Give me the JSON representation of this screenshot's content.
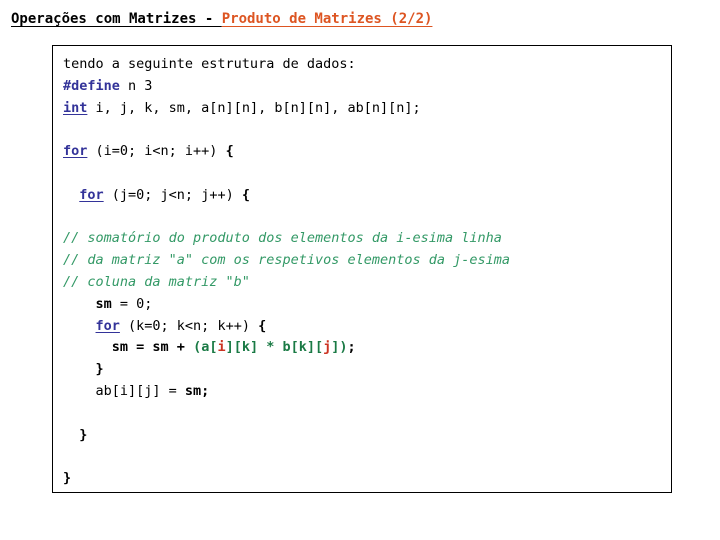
{
  "title": {
    "main": "Operações com Matrizes - ",
    "accent": "Produto de Matrizes (2/2)"
  },
  "colors": {
    "title_black": "#000000",
    "title_accent": "#dd5522",
    "keyword_navy": "#333399",
    "comment_green": "#339966",
    "expression_green": "#1a7a45",
    "index_red": "#cc3322",
    "border": "#000000",
    "background": "#ffffff"
  },
  "code": {
    "language": "C",
    "lines": [
      {
        "id": "line-1",
        "tokens": [
          {
            "style": "plain",
            "text": "tendo a seguinte estrutura de dados:"
          }
        ]
      },
      {
        "id": "line-2",
        "tokens": [
          {
            "style": "kw",
            "text": "#define"
          },
          {
            "style": "plain",
            "text": " n 3"
          }
        ]
      },
      {
        "id": "line-3",
        "tokens": [
          {
            "style": "kw-u",
            "text": "int"
          },
          {
            "style": "plain",
            "text": " i, j, k, sm, a[n][n], b[n][n], ab[n][n];"
          }
        ]
      },
      {
        "id": "line-4",
        "tokens": [
          {
            "style": "plain",
            "text": ""
          }
        ]
      },
      {
        "id": "line-5",
        "tokens": [
          {
            "style": "kw-u",
            "text": "for"
          },
          {
            "style": "plain",
            "text": " (i=0; i<n; i++) "
          },
          {
            "style": "bold",
            "text": "{"
          }
        ]
      },
      {
        "id": "line-6",
        "tokens": [
          {
            "style": "plain",
            "text": ""
          }
        ]
      },
      {
        "id": "line-7",
        "tokens": [
          {
            "style": "plain",
            "text": "  "
          },
          {
            "style": "kw-u",
            "text": "for"
          },
          {
            "style": "plain",
            "text": " (j=0; j<n; j++) "
          },
          {
            "style": "bold",
            "text": "{"
          }
        ]
      },
      {
        "id": "line-8",
        "tokens": [
          {
            "style": "plain",
            "text": ""
          }
        ]
      },
      {
        "id": "line-9",
        "tokens": [
          {
            "style": "comment",
            "text": "// somatório do produto dos elementos da i-esima linha"
          }
        ]
      },
      {
        "id": "line-10",
        "tokens": [
          {
            "style": "comment",
            "text": "// da matriz \"a\" com os respetivos elementos da j-esima"
          }
        ]
      },
      {
        "id": "line-11",
        "tokens": [
          {
            "style": "comment",
            "text": "// coluna da matriz \"b\""
          }
        ]
      },
      {
        "id": "line-12",
        "tokens": [
          {
            "style": "plain",
            "text": "    "
          },
          {
            "style": "bold",
            "text": "sm"
          },
          {
            "style": "plain",
            "text": " = 0;"
          }
        ]
      },
      {
        "id": "line-13",
        "tokens": [
          {
            "style": "plain",
            "text": "    "
          },
          {
            "style": "kw-u",
            "text": "for"
          },
          {
            "style": "plain",
            "text": " (k=0; k<n; k++) "
          },
          {
            "style": "bold",
            "text": "{"
          }
        ]
      },
      {
        "id": "line-14",
        "tokens": [
          {
            "style": "plain",
            "text": "      "
          },
          {
            "style": "bold",
            "text": "sm = sm + "
          },
          {
            "style": "expr",
            "text": "(a["
          },
          {
            "style": "index",
            "text": "i"
          },
          {
            "style": "expr",
            "text": "][k] * b[k]["
          },
          {
            "style": "index",
            "text": "j"
          },
          {
            "style": "expr",
            "text": "])"
          },
          {
            "style": "bold",
            "text": ";"
          }
        ]
      },
      {
        "id": "line-15",
        "tokens": [
          {
            "style": "plain",
            "text": "    "
          },
          {
            "style": "bold",
            "text": "}"
          }
        ]
      },
      {
        "id": "line-16",
        "tokens": [
          {
            "style": "plain",
            "text": "    ab[i][j] = "
          },
          {
            "style": "bold",
            "text": "sm;"
          }
        ]
      },
      {
        "id": "line-17",
        "tokens": [
          {
            "style": "plain",
            "text": ""
          }
        ]
      },
      {
        "id": "line-18",
        "tokens": [
          {
            "style": "plain",
            "text": "  "
          },
          {
            "style": "bold",
            "text": "}"
          }
        ]
      },
      {
        "id": "line-19",
        "tokens": [
          {
            "style": "plain",
            "text": ""
          }
        ]
      },
      {
        "id": "line-20",
        "tokens": [
          {
            "style": "bold",
            "text": "}"
          }
        ]
      }
    ]
  }
}
